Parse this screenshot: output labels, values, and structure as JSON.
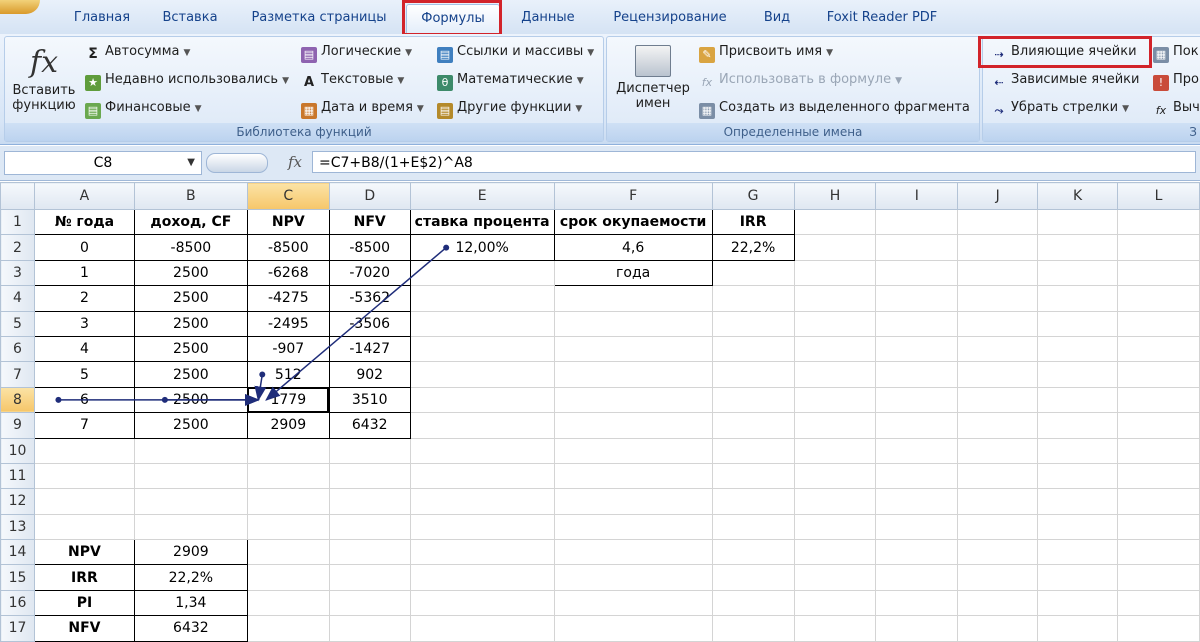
{
  "tabs": [
    "Главная",
    "Вставка",
    "Разметка страницы",
    "Формулы",
    "Данные",
    "Рецензирование",
    "Вид",
    "Foxit Reader PDF"
  ],
  "active_tab": "Формулы",
  "ribbon": {
    "insert_function": "Вставить функцию",
    "autosum": "Автосумма",
    "recent": "Недавно использовались",
    "financial": "Финансовые",
    "logical": "Логические",
    "text": "Текстовые",
    "datetime": "Дата и время",
    "lookup": "Ссылки и массивы",
    "math": "Математические",
    "other": "Другие функции",
    "library_label": "Библиотека функций",
    "name_manager": "Диспетчер имен",
    "define_name": "Присвоить имя",
    "use_in_formula": "Использовать в формуле",
    "create_from_selection": "Создать из выделенного фрагмента",
    "names_label": "Определенные имена",
    "trace_precedents": "Влияющие ячейки",
    "trace_dependents": "Зависимые ячейки",
    "remove_arrows": "Убрать стрелки",
    "cut_pro": "Про",
    "cut_show": "Пок",
    "cut_eval": "Выч",
    "cut_group_label": "З"
  },
  "formula_bar": {
    "name_box": "C8",
    "fx": "fx",
    "formula": "=C7+B8/(1+E$2)^A8"
  },
  "columns": [
    "A",
    "B",
    "C",
    "D",
    "E",
    "F",
    "G",
    "H",
    "I",
    "J",
    "K",
    "L"
  ],
  "rows": [
    [
      "№ года",
      "доход, CF",
      "NPV",
      "NFV",
      "ставка процента",
      "срок окупаемости",
      "IRR",
      "",
      "",
      "",
      "",
      ""
    ],
    [
      "0",
      "-8500",
      "-8500",
      "-8500",
      "12,00%",
      "4,6",
      "22,2%",
      "",
      "",
      "",
      "",
      ""
    ],
    [
      "1",
      "2500",
      "-6268",
      "-7020",
      "",
      "года",
      "",
      "",
      "",
      "",
      "",
      ""
    ],
    [
      "2",
      "2500",
      "-4275",
      "-5362",
      "",
      "",
      "",
      "",
      "",
      "",
      "",
      ""
    ],
    [
      "3",
      "2500",
      "-2495",
      "-3506",
      "",
      "",
      "",
      "",
      "",
      "",
      "",
      ""
    ],
    [
      "4",
      "2500",
      "-907",
      "-1427",
      "",
      "",
      "",
      "",
      "",
      "",
      "",
      ""
    ],
    [
      "5",
      "2500",
      "512",
      "902",
      "",
      "",
      "",
      "",
      "",
      "",
      "",
      ""
    ],
    [
      "6",
      "2500",
      "1779",
      "3510",
      "",
      "",
      "",
      "",
      "",
      "",
      "",
      ""
    ],
    [
      "7",
      "2500",
      "2909",
      "6432",
      "",
      "",
      "",
      "",
      "",
      "",
      "",
      ""
    ],
    [
      "",
      "",
      "",
      "",
      "",
      "",
      "",
      "",
      "",
      "",
      "",
      ""
    ],
    [
      "",
      "",
      "",
      "",
      "",
      "",
      "",
      "",
      "",
      "",
      "",
      ""
    ],
    [
      "",
      "",
      "",
      "",
      "",
      "",
      "",
      "",
      "",
      "",
      "",
      ""
    ],
    [
      "",
      "",
      "",
      "",
      "",
      "",
      "",
      "",
      "",
      "",
      "",
      ""
    ],
    [
      "NPV",
      "2909",
      "",
      "",
      "",
      "",
      "",
      "",
      "",
      "",
      "",
      ""
    ],
    [
      "IRR",
      "22,2%",
      "",
      "",
      "",
      "",
      "",
      "",
      "",
      "",
      "",
      ""
    ],
    [
      "PI",
      "1,34",
      "",
      "",
      "",
      "",
      "",
      "",
      "",
      "",
      "",
      ""
    ],
    [
      "NFV",
      "6432",
      "",
      "",
      "",
      "",
      "",
      "",
      "",
      "",
      "",
      ""
    ]
  ],
  "colors": {
    "highlight": "#d2232a",
    "arrow": "#1f2d7a"
  }
}
